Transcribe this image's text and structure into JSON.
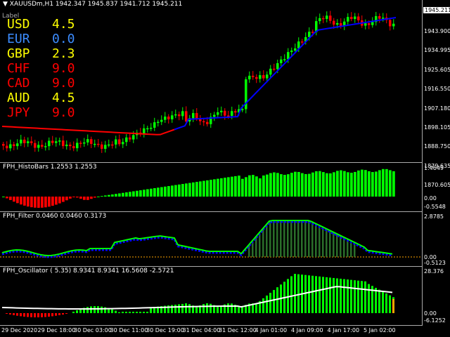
{
  "main": {
    "header": "▼ XAUUSDm,H1  1942.347 1945.837 1941.712 1945.211",
    "label": "Label",
    "current_price": "1945.211",
    "price_ticks": [
      "1943.900",
      "1934.995",
      "1925.605",
      "1916.550",
      "1907.180",
      "1898.105",
      "1888.750",
      "1879.635",
      "1870.605"
    ],
    "currencies": [
      {
        "name": "USD",
        "value": "4.5",
        "color": "#ffff00"
      },
      {
        "name": "EUR",
        "value": "0.0",
        "color": "#3c8cff"
      },
      {
        "name": "GBP",
        "value": "2.3",
        "color": "#ffff00"
      },
      {
        "name": "CHF",
        "value": "9.0",
        "color": "#ff0000"
      },
      {
        "name": "CAD",
        "value": "9.0",
        "color": "#ff0000"
      },
      {
        "name": "AUD",
        "value": "4.5",
        "color": "#ffff00"
      },
      {
        "name": "JPY",
        "value": "9.0",
        "color": "#ff0000"
      }
    ]
  },
  "histo": {
    "title": "FPH_HistoBars 1.2553 1.2553",
    "ticks": [
      "1.4649",
      "0.00",
      "-0.5548"
    ]
  },
  "filter": {
    "title": "FPH_Filter 0.0460 0.0460 0.3173",
    "ticks": [
      "2.8785",
      "0.00",
      "-0.5123"
    ]
  },
  "oscillator": {
    "title": "FPH_Oscillator ( 5.35) 8.9341 8.9341 16.5608 -2.5721",
    "ticks": [
      "28.376",
      "0.00",
      "-6.1252"
    ]
  },
  "time_axis": [
    "29 Dec 2020",
    "29 Dec 18:00",
    "30 Dec 03:00",
    "30 Dec 11:00",
    "30 Dec 19:00",
    "31 Dec 04:00",
    "31 Dec 12:00",
    "4 Jan 01:00",
    "4 Jan 09:00",
    "4 Jan 17:00",
    "5 Jan 02:00"
  ],
  "colors": {
    "bull": "#00ff00",
    "bear": "#ff0000",
    "ma_red": "#ff0000",
    "ma_blue": "#0000ff",
    "grid": "#aaaaaa",
    "filter_line": "#00ff00",
    "filter_blue": "#0000ff",
    "oscillator_line": "#ffffff",
    "zero_line": "#ffa500"
  }
}
